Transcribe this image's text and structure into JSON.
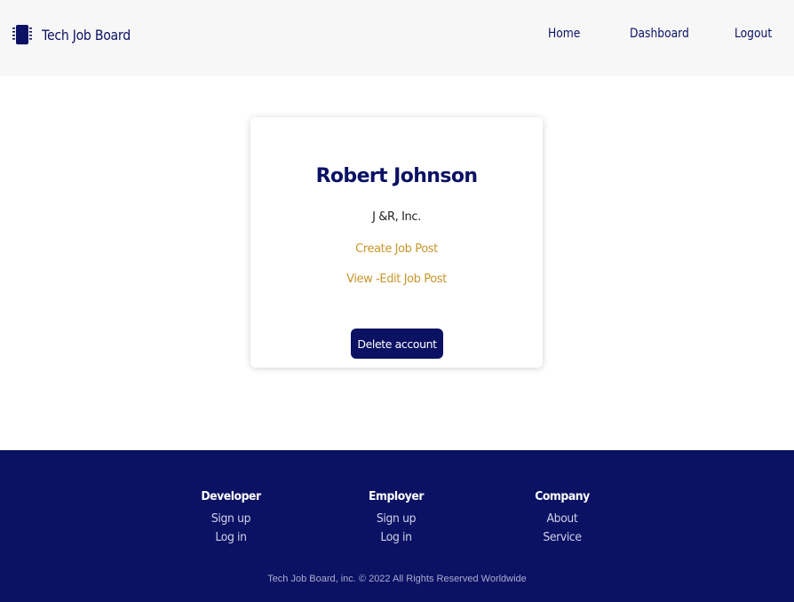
{
  "nav": {
    "brand_name": "Tech Job Board",
    "brand_icon": "chip-icon",
    "links": [
      "Home",
      "Dashboard",
      "Logout"
    ]
  },
  "profile": {
    "name": "Robert Johnson",
    "company": "J &R, Inc.",
    "create_link": "Create Job Post",
    "view_edit_link": "View -Edit Job Post",
    "delete_button": "Delete account"
  },
  "footer": {
    "columns": [
      {
        "heading": "Developer",
        "links": [
          "Sign up",
          "Log in"
        ]
      },
      {
        "heading": "Employer",
        "links": [
          "Sign up",
          "Log in"
        ]
      },
      {
        "heading": "Company",
        "links": [
          "About",
          "Service"
        ]
      }
    ],
    "copyright": "Tech Job Board, inc. © 2022 All Rights Reserved Worldwide"
  },
  "colors": {
    "primary": "#0b1163",
    "accent": "#c8962c",
    "nav_bg": "#f7f7f7"
  }
}
